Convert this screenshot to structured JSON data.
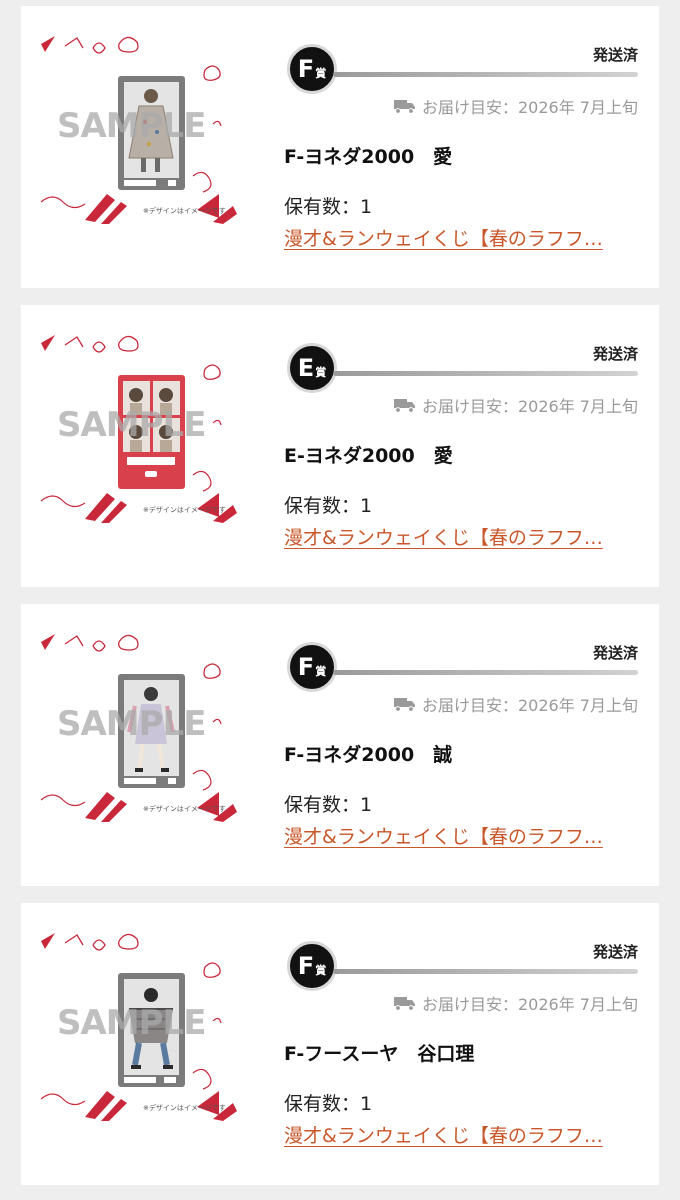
{
  "items": [
    {
      "badge_letter": "F",
      "badge_suffix": "賞",
      "status": "発送済",
      "delivery": "お届け目安：2026年 7月上旬",
      "title": "F-ヨネダ2000　愛",
      "quantity": "保有数：1",
      "link": "漫才&ランウェイくじ【春のラフフ…",
      "thumb": {
        "sample": "SAMPLE",
        "note": "※デザインはイメージです",
        "variant": "single"
      }
    },
    {
      "badge_letter": "E",
      "badge_suffix": "賞",
      "status": "発送済",
      "delivery": "お届け目安：2026年 7月上旬",
      "title": "E-ヨネダ2000　愛",
      "quantity": "保有数：1",
      "link": "漫才&ランウェイくじ【春のラフフ…",
      "thumb": {
        "sample": "SAMPLE",
        "note": "※デザインはイメージです",
        "variant": "quad"
      }
    },
    {
      "badge_letter": "F",
      "badge_suffix": "賞",
      "status": "発送済",
      "delivery": "お届け目安：2026年 7月上旬",
      "title": "F-ヨネダ2000　誠",
      "quantity": "保有数：1",
      "link": "漫才&ランウェイくじ【春のラフフ…",
      "thumb": {
        "sample": "SAMPLE",
        "note": "※デザインはイメージです",
        "variant": "single"
      }
    },
    {
      "badge_letter": "F",
      "badge_suffix": "賞",
      "status": "発送済",
      "delivery": "お届け目安：2026年 7月上旬",
      "title": "F-フースーヤ　谷口理",
      "quantity": "保有数：1",
      "link": "漫才&ランウェイくじ【春のラフフ…",
      "thumb": {
        "sample": "SAMPLE",
        "note": "※デザインはイメージです",
        "variant": "single"
      }
    }
  ],
  "colors": {
    "accent_link": "#c9572a",
    "status_text": "#222222",
    "delivery_text": "#9a9a9a",
    "badge_bg": "#111111",
    "decor_red": "#c8283a"
  },
  "icons": {
    "delivery": "truck-icon"
  }
}
